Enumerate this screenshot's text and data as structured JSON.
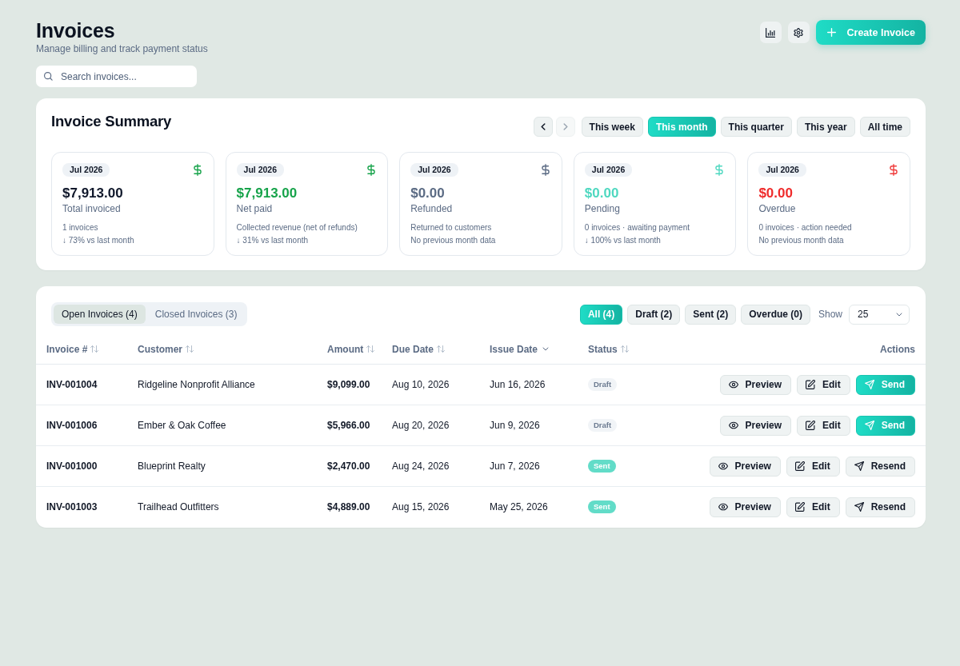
{
  "header": {
    "title": "Invoices",
    "subtitle": "Manage billing and track payment status",
    "tools": [
      {
        "kind": "chart"
      },
      {
        "kind": "settings"
      }
    ],
    "primary_action": {
      "label": "Create Invoice"
    }
  },
  "search": {
    "placeholder": "Search invoices..."
  },
  "summary": {
    "title": "Invoice Summary",
    "nav": [
      {
        "kind": "prev",
        "disabled": false
      },
      {
        "kind": "next",
        "disabled": true
      }
    ],
    "periods": [
      {
        "label": "This week",
        "selected": false
      },
      {
        "label": "This month",
        "selected": true
      },
      {
        "label": "This quarter",
        "selected": false
      },
      {
        "label": "This year",
        "selected": false
      },
      {
        "label": "All time",
        "selected": false
      }
    ],
    "cards": [
      {
        "badge": "Jul 2026",
        "amount": "$7,913.00",
        "label": "Total invoiced",
        "notes": [
          "1 invoices",
          "↓ 73% vs last month"
        ],
        "color": "#0f172a",
        "icon": {
          "color": "#16a34a"
        }
      },
      {
        "badge": "Jul 2026",
        "amount": "$7,913.00",
        "label": "Net paid",
        "notes": [
          "Collected revenue (net of refunds)",
          "↓ 31% vs last month"
        ],
        "color": "#16a34a",
        "icon": {
          "color": "#16a34a"
        }
      },
      {
        "badge": "Jul 2026",
        "amount": "$0.00",
        "label": "Refunded",
        "notes": [
          "Returned to customers",
          "No previous month data"
        ],
        "color": "#5b6b84",
        "icon": {
          "color": "#5b6b84"
        }
      },
      {
        "badge": "Jul 2026",
        "amount": "$0.00",
        "label": "Pending",
        "notes": [
          "0 invoices · awaiting payment",
          "↓ 100% vs last month"
        ],
        "color": "#4fd8c0",
        "icon": {
          "color": "#4fd8c0"
        }
      },
      {
        "badge": "Jul 2026",
        "amount": "$0.00",
        "label": "Overdue",
        "notes": [
          "0 invoices · action needed",
          "No previous month data"
        ],
        "color": "#ef2b2b",
        "icon": {
          "color": "#ef3b3b"
        }
      }
    ]
  },
  "table": {
    "tabs": [
      {
        "label": "Open Invoices (4)",
        "selected": true
      },
      {
        "label": "Closed Invoices (3)",
        "selected": false
      }
    ],
    "filters": [
      {
        "label": "All (4)",
        "selected": true
      },
      {
        "label": "Draft (2)",
        "selected": false
      },
      {
        "label": "Sent (2)",
        "selected": false
      },
      {
        "label": "Overdue (0)",
        "selected": false
      }
    ],
    "page_size": {
      "label": "Show",
      "value": "25"
    },
    "columns": [
      {
        "label": "Invoice #",
        "sortable": true,
        "sorted": false
      },
      {
        "label": "Customer",
        "sortable": true,
        "sorted": false
      },
      {
        "label": "Amount",
        "sortable": true,
        "sorted": false
      },
      {
        "label": "Due Date",
        "sortable": true,
        "sorted": false
      },
      {
        "label": "Issue Date",
        "sortable": true,
        "sorted": true
      },
      {
        "label": "Status",
        "sortable": true,
        "sorted": false
      },
      {
        "label": "Actions",
        "sortable": false,
        "sorted": false
      }
    ],
    "rows": [
      {
        "invoice": "INV-001004",
        "customer": "Ridgeline Nonprofit Alliance",
        "amount": "$9,099.00",
        "due": "Aug 10, 2026",
        "issued": "Jun 16, 2026",
        "status": {
          "label": "Draft",
          "kind": "draft"
        },
        "actions": [
          {
            "label": "Preview",
            "kind": "preview",
            "primary": false
          },
          {
            "label": "Edit",
            "kind": "edit",
            "primary": false
          },
          {
            "label": "Send",
            "kind": "send",
            "primary": true
          }
        ]
      },
      {
        "invoice": "INV-001006",
        "customer": "Ember & Oak Coffee",
        "amount": "$5,966.00",
        "due": "Aug 20, 2026",
        "issued": "Jun 9, 2026",
        "status": {
          "label": "Draft",
          "kind": "draft"
        },
        "actions": [
          {
            "label": "Preview",
            "kind": "preview",
            "primary": false
          },
          {
            "label": "Edit",
            "kind": "edit",
            "primary": false
          },
          {
            "label": "Send",
            "kind": "send",
            "primary": true
          }
        ]
      },
      {
        "invoice": "INV-001000",
        "customer": "Blueprint Realty",
        "amount": "$2,470.00",
        "due": "Aug 24, 2026",
        "issued": "Jun 7, 2026",
        "status": {
          "label": "Sent",
          "kind": "sent"
        },
        "actions": [
          {
            "label": "Preview",
            "kind": "preview",
            "primary": false
          },
          {
            "label": "Edit",
            "kind": "edit",
            "primary": false
          },
          {
            "label": "Resend",
            "kind": "send",
            "primary": false
          }
        ]
      },
      {
        "invoice": "INV-001003",
        "customer": "Trailhead Outfitters",
        "amount": "$4,889.00",
        "due": "Aug 15, 2026",
        "issued": "May 25, 2026",
        "status": {
          "label": "Sent",
          "kind": "sent"
        },
        "actions": [
          {
            "label": "Preview",
            "kind": "preview",
            "primary": false
          },
          {
            "label": "Edit",
            "kind": "edit",
            "primary": false
          },
          {
            "label": "Resend",
            "kind": "send",
            "primary": false
          }
        ]
      }
    ]
  }
}
